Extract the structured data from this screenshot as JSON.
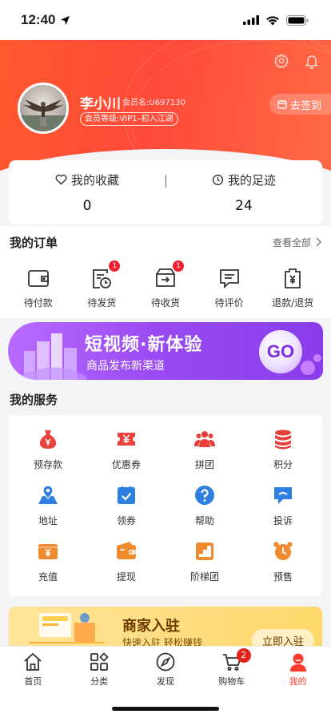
{
  "status_bar": {
    "time": "12:40"
  },
  "profile": {
    "name": "李小川",
    "member_no": "会员名:U697130",
    "level": "会员等级:VIP1–初入江湖",
    "signin_label": "去签到"
  },
  "fav": {
    "collection_label": "我的收藏",
    "collection_count": "0",
    "footprint_label": "我的足迹",
    "footprint_count": "24"
  },
  "orders": {
    "title": "我的订单",
    "more": "查看全部",
    "items": [
      {
        "label": "待付款",
        "icon": "wallet-icon",
        "badge": ""
      },
      {
        "label": "待发货",
        "icon": "pending-ship-icon",
        "badge": "1"
      },
      {
        "label": "待收货",
        "icon": "delivery-box-icon",
        "badge": "1"
      },
      {
        "label": "待评价",
        "icon": "comment-icon",
        "badge": ""
      },
      {
        "label": "退款/退货",
        "icon": "refund-icon",
        "badge": ""
      }
    ]
  },
  "banner": {
    "title": "短视频·新体验",
    "subtitle": "商品发布新渠道",
    "go": "GO"
  },
  "services": {
    "title": "我的服务",
    "items": [
      {
        "label": "预存款",
        "icon": "money-bag-icon",
        "color": "#e8413b"
      },
      {
        "label": "优惠券",
        "icon": "coupon-icon",
        "color": "#e8413b"
      },
      {
        "label": "拼团",
        "icon": "group-icon",
        "color": "#e8413b"
      },
      {
        "label": "积分",
        "icon": "coins-icon",
        "color": "#e8413b"
      },
      {
        "label": "地址",
        "icon": "map-icon",
        "color": "#2f7fe0"
      },
      {
        "label": "领券",
        "icon": "ticket-check-icon",
        "color": "#2f7fe0"
      },
      {
        "label": "帮助",
        "icon": "help-icon",
        "color": "#2f7fe0"
      },
      {
        "label": "投诉",
        "icon": "complaint-icon",
        "color": "#2f7fe0"
      },
      {
        "label": "充值",
        "icon": "recharge-icon",
        "color": "#f08a2e"
      },
      {
        "label": "提现",
        "icon": "withdraw-icon",
        "color": "#f08a2e"
      },
      {
        "label": "阶梯团",
        "icon": "ladder-group-icon",
        "color": "#f08a2e"
      },
      {
        "label": "预售",
        "icon": "alarm-clock-icon",
        "color": "#f08a2e"
      }
    ]
  },
  "merchant": {
    "title": "商家入驻",
    "subtitle": "快速入驻 轻松赚钱",
    "button": "立即入驻"
  },
  "tabbar": {
    "items": [
      {
        "label": "首页",
        "icon": "home-icon"
      },
      {
        "label": "分类",
        "icon": "category-icon"
      },
      {
        "label": "发现",
        "icon": "compass-icon"
      },
      {
        "label": "购物车",
        "icon": "cart-icon",
        "badge": "2"
      },
      {
        "label": "我的",
        "icon": "profile-icon",
        "active": true
      }
    ]
  },
  "colors": {
    "accent": "#ff3b2f",
    "banner_purple": "#9a4bf2"
  }
}
